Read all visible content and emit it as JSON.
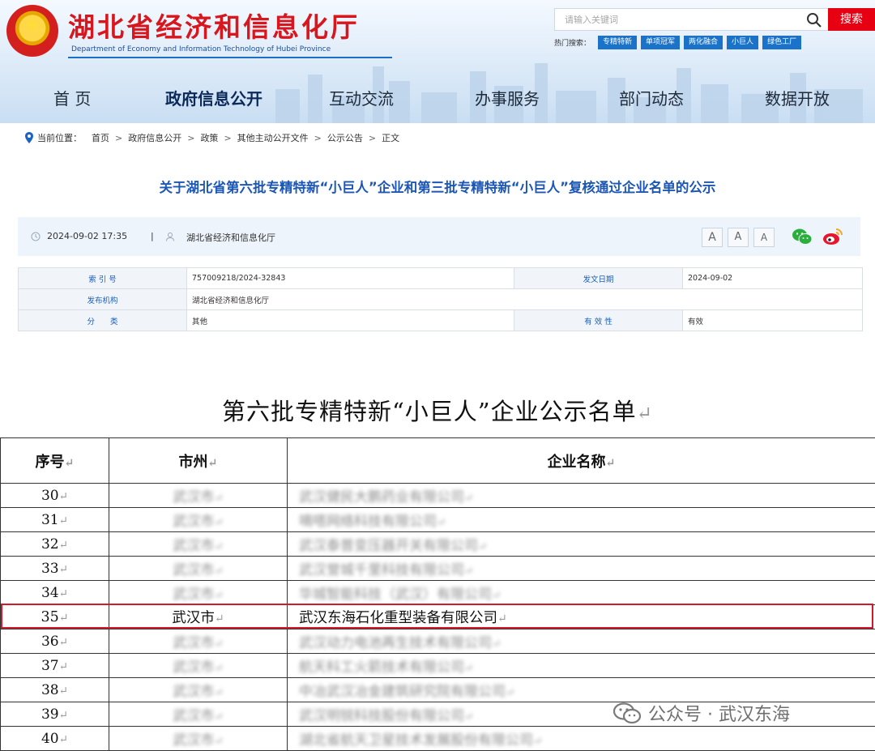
{
  "header": {
    "site_title": "湖北省经济和信息化厅",
    "site_subtitle": "Department of Economy and Information Technology of Hubei Province",
    "search_placeholder": "请输入关键词",
    "search_button": "搜索",
    "hot_label": "热门搜索：",
    "hot_tags": [
      "专精特新",
      "单项冠军",
      "两化融合",
      "小巨人",
      "绿色工厂"
    ],
    "nav": [
      "首 页",
      "政府信息公开",
      "互动交流",
      "办事服务",
      "部门动态",
      "数据开放"
    ],
    "colors": {
      "title_red": "#d8161d",
      "accent_blue": "#1a73c9",
      "search_red": "#e60012"
    }
  },
  "breadcrumb": {
    "label": "当前位置：",
    "items": [
      "首页",
      "政府信息公开",
      "政策",
      "其他主动公开文件",
      "公示公告",
      "正文"
    ]
  },
  "article": {
    "title": "关于湖北省第六批专精特新“小巨人”企业和第三批专精特新“小巨人”复核通过企业名单的公示",
    "datetime": "2024-09-02 17:35",
    "separator": "|",
    "source": "湖北省经济和信息化厅",
    "font_sizes": [
      "A",
      "A",
      "A"
    ],
    "info": {
      "index_label": "索 引 号",
      "index_value": "757009218/2024-32843",
      "date_label": "发文日期",
      "date_value": "2024-09-02",
      "org_label": "发布机构",
      "org_value": "湖北省经济和信息化厅",
      "category_label": "分　　类",
      "category_value": "其他",
      "validity_label": "有 效 性",
      "validity_value": "有效"
    }
  },
  "document": {
    "title": "第六批专精特新“小巨人”企业公示名单",
    "return_mark": "↵",
    "headers": [
      "序号",
      "市州",
      "企业名称"
    ],
    "rows": [
      {
        "no": "30",
        "city": "武汉市",
        "name": "武汉健民大鹏药业有限公司",
        "blurred": true
      },
      {
        "no": "31",
        "city": "武汉市",
        "name": "嘀嗒网络科技有限公司",
        "blurred": true
      },
      {
        "no": "32",
        "city": "武汉市",
        "name": "武汉泰普变压器开关有限公司",
        "blurred": true
      },
      {
        "no": "33",
        "city": "武汉市",
        "name": "武汉誉城千里科技有限公司",
        "blurred": true
      },
      {
        "no": "34",
        "city": "武汉市",
        "name": "华城智能科技（武汉）有限公司",
        "blurred": true
      },
      {
        "no": "35",
        "city": "武汉市",
        "name": "武汉东海石化重型装备有限公司",
        "blurred": false
      },
      {
        "no": "36",
        "city": "武汉市",
        "name": "武汉动力电池再生技术有限公司",
        "blurred": true
      },
      {
        "no": "37",
        "city": "武汉市",
        "name": "航天科工火箭技术有限公司",
        "blurred": true
      },
      {
        "no": "38",
        "city": "武汉市",
        "name": "中冶武汉冶金建筑研究院有限公司",
        "blurred": true
      },
      {
        "no": "39",
        "city": "武汉市",
        "name": "武汉明锐科技股份有限公司",
        "blurred": true
      },
      {
        "no": "40",
        "city": "武汉市",
        "name": "湖北省航天卫星技术发展股份有限公司",
        "blurred": true
      }
    ],
    "highlight_color": "#d21b2a"
  },
  "watermark": {
    "text": "公众号 · 武汉东海"
  }
}
